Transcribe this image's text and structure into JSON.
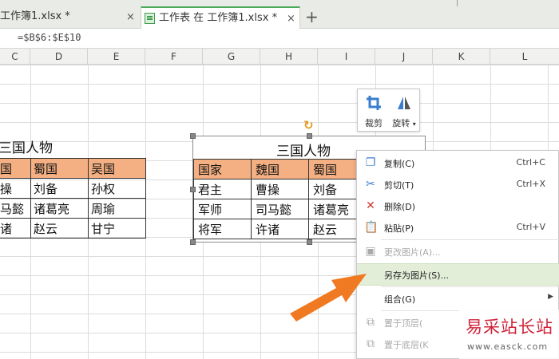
{
  "tabs": [
    {
      "label": "工作簿1.xlsx *",
      "close": "×"
    },
    {
      "label": "工作表 在 工作簿1.xlsx *",
      "close": "×"
    }
  ],
  "new_tab": "+",
  "formula": "=$B$6:$E$10",
  "columns": [
    "C",
    "D",
    "E",
    "F",
    "G",
    "H",
    "I",
    "J",
    "K",
    "L"
  ],
  "left_table": {
    "title": "三国人物",
    "rows": [
      [
        "国",
        "蜀国",
        "吴国"
      ],
      [
        "操",
        "刘备",
        "孙权"
      ],
      [
        "马懿",
        "诸葛亮",
        "周瑜"
      ],
      [
        "诸",
        "赵云",
        "甘宁"
      ]
    ],
    "header_color": "#f4b083"
  },
  "picture_table": {
    "title": "三国人物",
    "rows": [
      [
        "国家",
        "魏国",
        "蜀国"
      ],
      [
        "君主",
        "曹操",
        "刘备"
      ],
      [
        "军师",
        "司马懿",
        "诸葛亮"
      ],
      [
        "将军",
        "许诸",
        "赵云"
      ]
    ]
  },
  "mini_toolbar": {
    "crop": "裁剪",
    "rotate": "旋转",
    "rotate_caret": "▾"
  },
  "context_menu": {
    "copy": {
      "label": "复制(C)",
      "shortcut": "Ctrl+C"
    },
    "cut": {
      "label": "剪切(T)",
      "shortcut": "Ctrl+X"
    },
    "delete": {
      "label": "删除(D)"
    },
    "paste": {
      "label": "粘贴(P)",
      "shortcut": "Ctrl+V"
    },
    "change_picture": {
      "label": "更改图片(A)..."
    },
    "save_as_picture": {
      "label": "另存为图片(S)..."
    },
    "group": {
      "label": "组合(G)",
      "arrow": "▶"
    },
    "bring_to_top": {
      "label": "置于顶层("
    },
    "send_to_bottom": {
      "label": "置于底层(K"
    }
  },
  "watermark": {
    "brand": "易采站长站",
    "url": "www.easck.com"
  },
  "colors": {
    "accent_green": "#4aa85a",
    "arrow_orange": "#f07a22",
    "highlight": "#e3eed9"
  }
}
